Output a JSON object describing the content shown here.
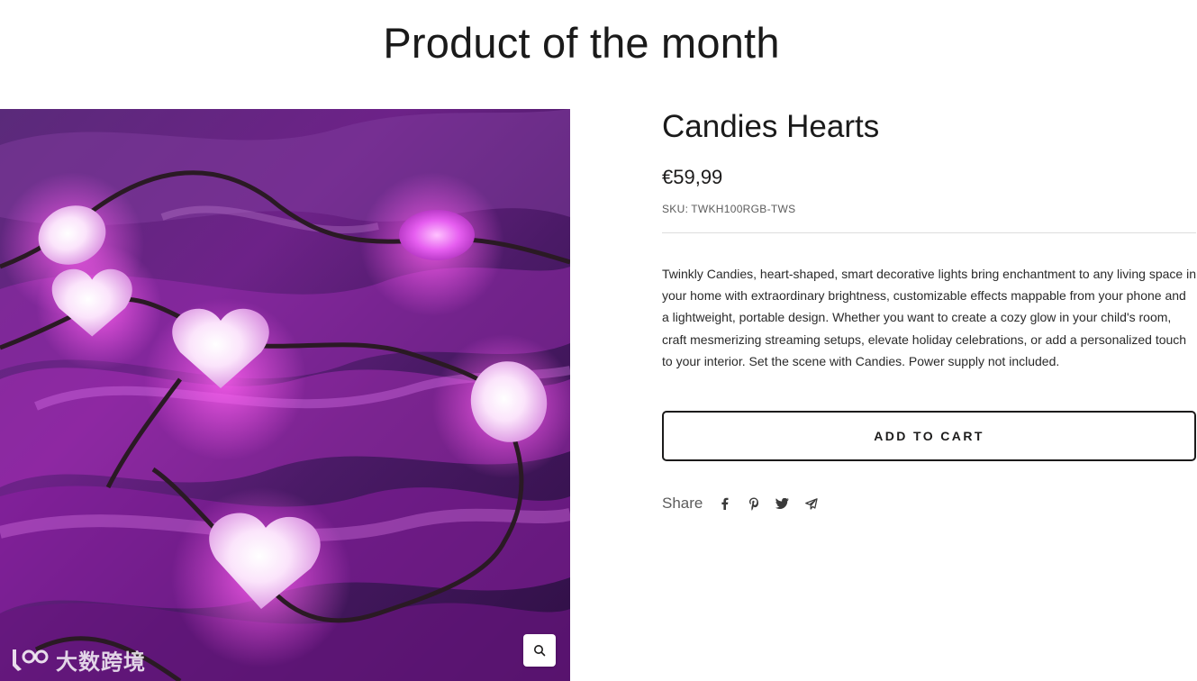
{
  "section": {
    "title": "Product of the month"
  },
  "product": {
    "name": "Candies Hearts",
    "price": "€59,99",
    "sku_label": "SKU:",
    "sku_value": "TWKH100RGB-TWS",
    "description": "Twinkly Candies, heart-shaped, smart decorative lights bring enchantment to any living space in your home with extraordinary brightness, customizable effects mappable from your phone and a lightweight, portable design. Whether you want to create a cozy glow in your child's room, craft mesmerizing streaming setups, elevate holiday celebrations, or add a personalized touch to your interior. Set the scene with Candies.  Power supply not included.",
    "add_to_cart_label": "ADD TO CART",
    "image_icon": "zoom-icon"
  },
  "share": {
    "label": "Share",
    "icons": [
      "facebook-icon",
      "pinterest-icon",
      "twitter-icon",
      "email-send-icon"
    ]
  },
  "watermark": {
    "text": "大数跨境"
  },
  "colors": {
    "text": "#1c1b1b",
    "muted": "#5c5c5c",
    "divider": "#dddddd",
    "background": "#ffffff",
    "image_purple": "#7a1f8c",
    "image_glow": "#e58cf0"
  }
}
